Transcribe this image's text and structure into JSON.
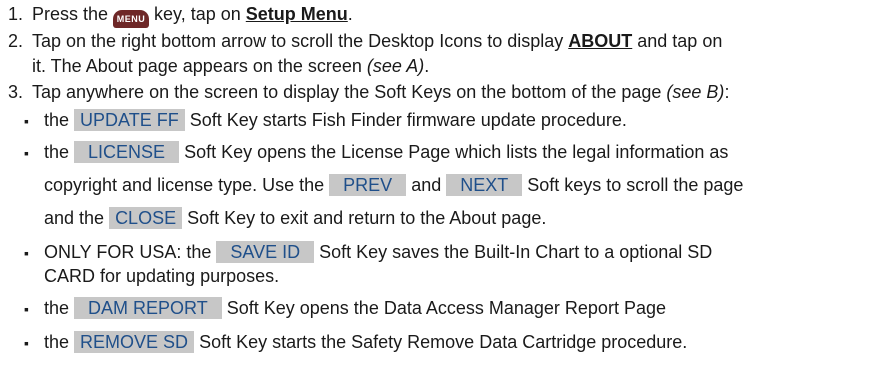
{
  "steps": [
    {
      "num": "1.",
      "a": "Press the ",
      "icon": "MENU",
      "b": " key, tap on ",
      "link": "Setup Menu",
      "c": "."
    },
    {
      "num": "2.",
      "a": "Tap on the right bottom arrow to scroll the Desktop Icons to display ",
      "link": "ABOUT",
      "b": " and tap on",
      "line2a": "it. The About page appears on the screen ",
      "line2b": "(see A)",
      "line2c": "."
    },
    {
      "num": "3.",
      "a": "Tap anywhere on the screen to display the Soft Keys on the bottom of the page ",
      "b": "(see B)",
      "c": ":"
    }
  ],
  "bullets": {
    "symbol": "▪",
    "b1": {
      "a": "the ",
      "key": "UPDATE FF",
      "b": " Soft Key starts Fish Finder firmware update procedure."
    },
    "b2": {
      "a": "the ",
      "key": "LICENSE",
      "b": " Soft Key opens the License Page which lists the legal information as",
      "line2a": "copyright and license type. Use the ",
      "key2": "PREV",
      "line2b": " and ",
      "key3": "NEXT",
      "line2c": " Soft keys to scroll the page",
      "line3a": "and the ",
      "key4": "CLOSE",
      "line3b": " Soft Key to exit and return to the About page."
    },
    "b3": {
      "a": "ONLY FOR USA: the ",
      "key": "SAVE ID",
      "b": " Soft Key saves the Built-In Chart to a optional SD",
      "line2": "CARD for updating purposes."
    },
    "b4": {
      "a": "the ",
      "key": "DAM REPORT",
      "b": " Soft Key opens the Data Access Manager Report Page"
    },
    "b5": {
      "a": "the ",
      "key": "REMOVE SD",
      "b": " Soft Key starts the Safety Remove Data Cartridge procedure."
    }
  }
}
